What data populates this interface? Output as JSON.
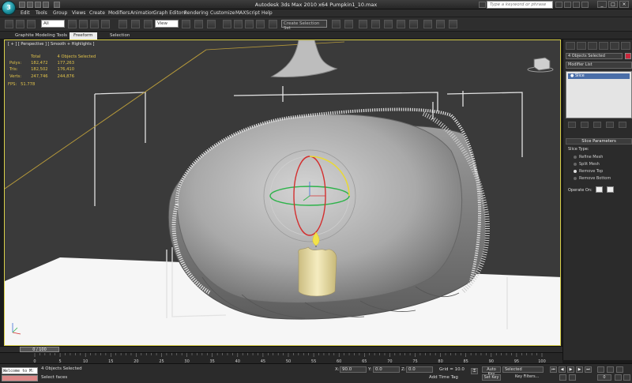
{
  "window": {
    "title": "Autodesk 3ds Max  2010 x64      Pumpkin1_10.max",
    "logo": "3",
    "help_placeholder": "Type a keyword or phrase"
  },
  "menu": [
    "Edit",
    "Tools",
    "Group",
    "Views",
    "Create",
    "Modifiers",
    "Animation",
    "Graph Editors",
    "Rendering",
    "Customize",
    "MAXScript",
    "Help"
  ],
  "toolbar": {
    "filter_value": "All",
    "refcoord_value": "View",
    "named_selection": "Create Selection Set"
  },
  "ribbon": {
    "tabs": [
      "Graphite Modeling Tools",
      "Freeform",
      "Selection"
    ],
    "active": 1
  },
  "viewport": {
    "label": "[ + ] [ Perspective ] [ Smooth + Highlights ]",
    "stats": {
      "header": [
        "Total",
        "4 Objects Selected"
      ],
      "rows": [
        [
          "Polys:",
          "182,472",
          "177,263"
        ],
        [
          "Tris:",
          "182,502",
          "176,410"
        ],
        [
          "Verts:",
          "247,746",
          "244,876"
        ]
      ],
      "fps_label": "FPS:",
      "fps_value": "51.778"
    }
  },
  "command_panel": {
    "object_name": "4 Objects Selected",
    "modifier_list": "Modifier List",
    "stack_item": "Slice",
    "rollout_title": "Slice Parameters",
    "slice_type_label": "Slice Type:",
    "options": [
      "Refine Mesh",
      "Split Mesh",
      "Remove Top",
      "Remove Bottom"
    ],
    "selected_option": 2,
    "operate_on_label": "Operate On:"
  },
  "timeline": {
    "slider": "0 / 100",
    "ticks": [
      "0",
      "5",
      "10",
      "15",
      "20",
      "25",
      "30",
      "35",
      "40",
      "45",
      "50",
      "55",
      "60",
      "65",
      "70",
      "75",
      "80",
      "85",
      "90",
      "95",
      "100"
    ]
  },
  "status": {
    "maxscript": "Welcome to M:",
    "selection": "4 Objects Selected",
    "prompt": "Select faces",
    "x_label": "X:",
    "x_value": "90.0",
    "y_label": "Y:",
    "y_value": "0.0",
    "z_label": "Z:",
    "z_value": "0.0",
    "grid": "Grid = 10.0",
    "add_time_tag": "Add Time Tag",
    "auto_key": "Auto Key",
    "set_key": "Set Key",
    "selected_combo": "Selected",
    "key_filters": "Key Filters...",
    "frame": "0"
  },
  "colors": {
    "accent": "#d9d04a",
    "selection_swatch": "#c8283c",
    "candle": "#efe2a6",
    "flame": "#f2e24a",
    "pumpkin_inner": "#b9b9b9",
    "pumpkin_outer": "#8d8d8d"
  }
}
